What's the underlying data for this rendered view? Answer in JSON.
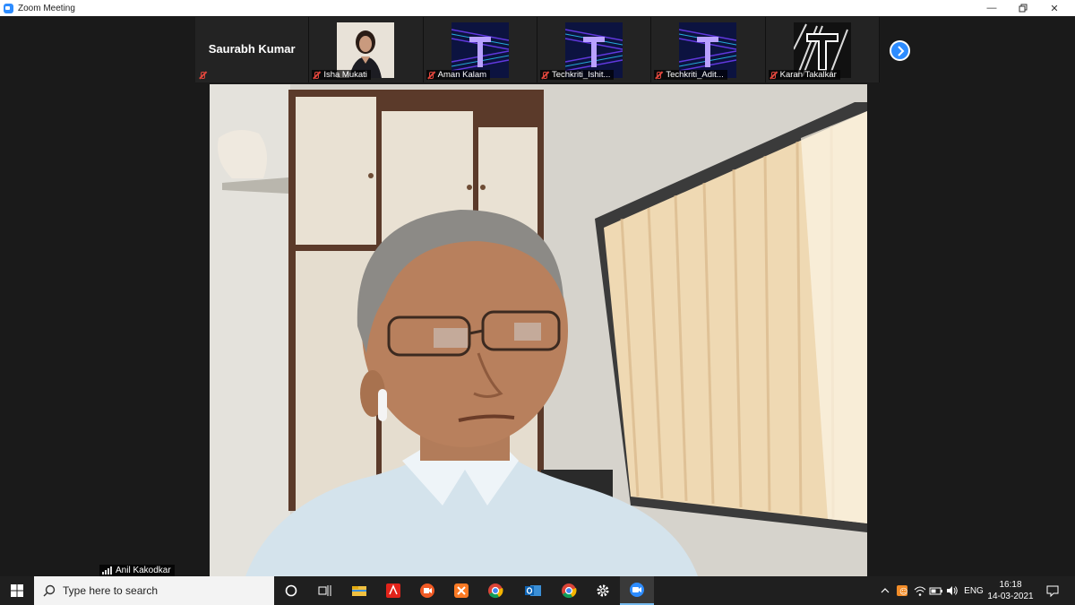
{
  "window": {
    "title": "Zoom Meeting"
  },
  "thumbnails": [
    {
      "name": "Saurabh Kumar",
      "type": "name-only",
      "muted": true
    },
    {
      "name": "Isha Mukati",
      "type": "photo",
      "muted": true
    },
    {
      "name": "Aman Kalam",
      "type": "logo",
      "muted": true
    },
    {
      "name": "Techkriti_Ishit...",
      "type": "logo",
      "muted": true
    },
    {
      "name": "Techkriti_Adit...",
      "type": "logo",
      "muted": true
    },
    {
      "name": "Karan Takalkar",
      "type": "logo-bw",
      "muted": true
    }
  ],
  "speaker": {
    "name": "Anil Kakodkar"
  },
  "taskbar": {
    "search_placeholder": "Type here to search",
    "apps": [
      "cortana-icon",
      "task-view-icon",
      "file-explorer-icon",
      "acrobat-icon",
      "screen-recorder-icon",
      "xampp-icon",
      "chrome-icon",
      "outlook-icon",
      "chrome-icon",
      "settings-icon",
      "zoom-icon"
    ],
    "language": "ENG",
    "time": "16:18",
    "date": "14-03-2021"
  },
  "colors": {
    "zoom_blue": "#2d8cff",
    "mute_red": "#e0463c",
    "background": "#1a1a1a"
  }
}
